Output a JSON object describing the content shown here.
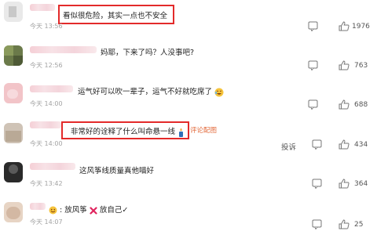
{
  "comments": [
    {
      "time": "今天 13:56",
      "text": "看似很危险，其实一点也不安全",
      "likes": "1976"
    },
    {
      "time": "今天 12:56",
      "text": "妈耶，下来了吗？人没事吧?",
      "likes": "763"
    },
    {
      "time": "今天 14:00",
      "text": "运气好可以吹一辈子，运气不好就吃席了",
      "likes": "688"
    },
    {
      "time": "今天 14:00",
      "text": "非常好的诠释了什么叫命悬一线",
      "likes": "434",
      "link": "评论配图",
      "toast": "投诉"
    },
    {
      "time": "今天 13:42",
      "text": "这风筝线质量真他喵好",
      "likes": "364"
    },
    {
      "time": "今天 14:07",
      "text_a": "放风筝",
      "text_b": "放自己",
      "check": "✓",
      "likes": "25"
    }
  ],
  "colors": {
    "highlight": "#e32a2a",
    "link": "#e36c3e",
    "time": "#a3a3a3"
  }
}
